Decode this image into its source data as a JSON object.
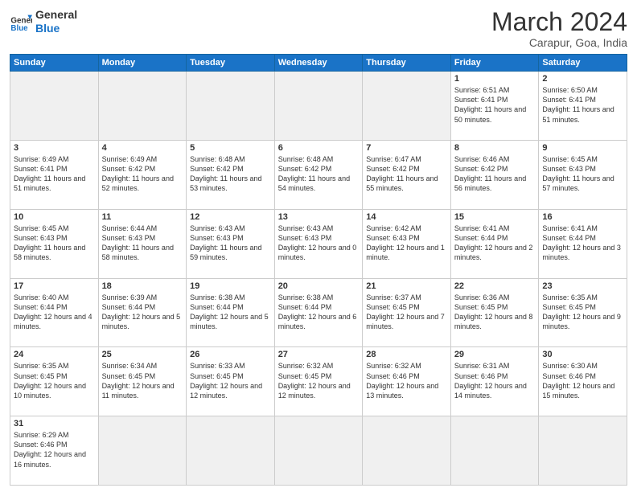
{
  "header": {
    "logo_general": "General",
    "logo_blue": "Blue",
    "title": "March 2024",
    "subtitle": "Carapur, Goa, India"
  },
  "columns": [
    "Sunday",
    "Monday",
    "Tuesday",
    "Wednesday",
    "Thursday",
    "Friday",
    "Saturday"
  ],
  "weeks": [
    [
      {
        "day": "",
        "info": ""
      },
      {
        "day": "",
        "info": ""
      },
      {
        "day": "",
        "info": ""
      },
      {
        "day": "",
        "info": ""
      },
      {
        "day": "",
        "info": ""
      },
      {
        "day": "1",
        "info": "Sunrise: 6:51 AM\nSunset: 6:41 PM\nDaylight: 11 hours\nand 50 minutes."
      },
      {
        "day": "2",
        "info": "Sunrise: 6:50 AM\nSunset: 6:41 PM\nDaylight: 11 hours\nand 51 minutes."
      }
    ],
    [
      {
        "day": "3",
        "info": "Sunrise: 6:49 AM\nSunset: 6:41 PM\nDaylight: 11 hours\nand 51 minutes."
      },
      {
        "day": "4",
        "info": "Sunrise: 6:49 AM\nSunset: 6:42 PM\nDaylight: 11 hours\nand 52 minutes."
      },
      {
        "day": "5",
        "info": "Sunrise: 6:48 AM\nSunset: 6:42 PM\nDaylight: 11 hours\nand 53 minutes."
      },
      {
        "day": "6",
        "info": "Sunrise: 6:48 AM\nSunset: 6:42 PM\nDaylight: 11 hours\nand 54 minutes."
      },
      {
        "day": "7",
        "info": "Sunrise: 6:47 AM\nSunset: 6:42 PM\nDaylight: 11 hours\nand 55 minutes."
      },
      {
        "day": "8",
        "info": "Sunrise: 6:46 AM\nSunset: 6:42 PM\nDaylight: 11 hours\nand 56 minutes."
      },
      {
        "day": "9",
        "info": "Sunrise: 6:45 AM\nSunset: 6:43 PM\nDaylight: 11 hours\nand 57 minutes."
      }
    ],
    [
      {
        "day": "10",
        "info": "Sunrise: 6:45 AM\nSunset: 6:43 PM\nDaylight: 11 hours\nand 58 minutes."
      },
      {
        "day": "11",
        "info": "Sunrise: 6:44 AM\nSunset: 6:43 PM\nDaylight: 11 hours\nand 58 minutes."
      },
      {
        "day": "12",
        "info": "Sunrise: 6:43 AM\nSunset: 6:43 PM\nDaylight: 11 hours\nand 59 minutes."
      },
      {
        "day": "13",
        "info": "Sunrise: 6:43 AM\nSunset: 6:43 PM\nDaylight: 12 hours\nand 0 minutes."
      },
      {
        "day": "14",
        "info": "Sunrise: 6:42 AM\nSunset: 6:43 PM\nDaylight: 12 hours\nand 1 minute."
      },
      {
        "day": "15",
        "info": "Sunrise: 6:41 AM\nSunset: 6:44 PM\nDaylight: 12 hours\nand 2 minutes."
      },
      {
        "day": "16",
        "info": "Sunrise: 6:41 AM\nSunset: 6:44 PM\nDaylight: 12 hours\nand 3 minutes."
      }
    ],
    [
      {
        "day": "17",
        "info": "Sunrise: 6:40 AM\nSunset: 6:44 PM\nDaylight: 12 hours\nand 4 minutes."
      },
      {
        "day": "18",
        "info": "Sunrise: 6:39 AM\nSunset: 6:44 PM\nDaylight: 12 hours\nand 5 minutes."
      },
      {
        "day": "19",
        "info": "Sunrise: 6:38 AM\nSunset: 6:44 PM\nDaylight: 12 hours\nand 5 minutes."
      },
      {
        "day": "20",
        "info": "Sunrise: 6:38 AM\nSunset: 6:44 PM\nDaylight: 12 hours\nand 6 minutes."
      },
      {
        "day": "21",
        "info": "Sunrise: 6:37 AM\nSunset: 6:45 PM\nDaylight: 12 hours\nand 7 minutes."
      },
      {
        "day": "22",
        "info": "Sunrise: 6:36 AM\nSunset: 6:45 PM\nDaylight: 12 hours\nand 8 minutes."
      },
      {
        "day": "23",
        "info": "Sunrise: 6:35 AM\nSunset: 6:45 PM\nDaylight: 12 hours\nand 9 minutes."
      }
    ],
    [
      {
        "day": "24",
        "info": "Sunrise: 6:35 AM\nSunset: 6:45 PM\nDaylight: 12 hours\nand 10 minutes."
      },
      {
        "day": "25",
        "info": "Sunrise: 6:34 AM\nSunset: 6:45 PM\nDaylight: 12 hours\nand 11 minutes."
      },
      {
        "day": "26",
        "info": "Sunrise: 6:33 AM\nSunset: 6:45 PM\nDaylight: 12 hours\nand 12 minutes."
      },
      {
        "day": "27",
        "info": "Sunrise: 6:32 AM\nSunset: 6:45 PM\nDaylight: 12 hours\nand 12 minutes."
      },
      {
        "day": "28",
        "info": "Sunrise: 6:32 AM\nSunset: 6:46 PM\nDaylight: 12 hours\nand 13 minutes."
      },
      {
        "day": "29",
        "info": "Sunrise: 6:31 AM\nSunset: 6:46 PM\nDaylight: 12 hours\nand 14 minutes."
      },
      {
        "day": "30",
        "info": "Sunrise: 6:30 AM\nSunset: 6:46 PM\nDaylight: 12 hours\nand 15 minutes."
      }
    ],
    [
      {
        "day": "31",
        "info": "Sunrise: 6:29 AM\nSunset: 6:46 PM\nDaylight: 12 hours\nand 16 minutes."
      },
      {
        "day": "",
        "info": ""
      },
      {
        "day": "",
        "info": ""
      },
      {
        "day": "",
        "info": ""
      },
      {
        "day": "",
        "info": ""
      },
      {
        "day": "",
        "info": ""
      },
      {
        "day": "",
        "info": ""
      }
    ]
  ]
}
